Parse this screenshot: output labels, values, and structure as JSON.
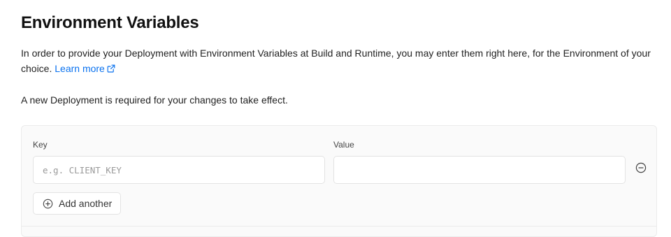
{
  "page": {
    "title": "Environment Variables",
    "description": "In order to provide your Deployment with Environment Variables at Build and Runtime, you may enter them right here, for the Environment of your choice.",
    "learn_more_label": "Learn more",
    "notice": "A new Deployment is required for your changes to take effect."
  },
  "form": {
    "key_label": "Key",
    "value_label": "Value",
    "rows": [
      {
        "key_value": "",
        "key_placeholder": "e.g. CLIENT_KEY",
        "value_value": ""
      }
    ],
    "add_another_label": "Add another"
  },
  "icons": {
    "learn_more": "external-link-icon",
    "remove_row": "minus-circle-icon",
    "add_row": "plus-circle-icon"
  },
  "colors": {
    "link": "#0a72ef",
    "panel_background": "#fafafa",
    "border": "#e3e3e3"
  }
}
